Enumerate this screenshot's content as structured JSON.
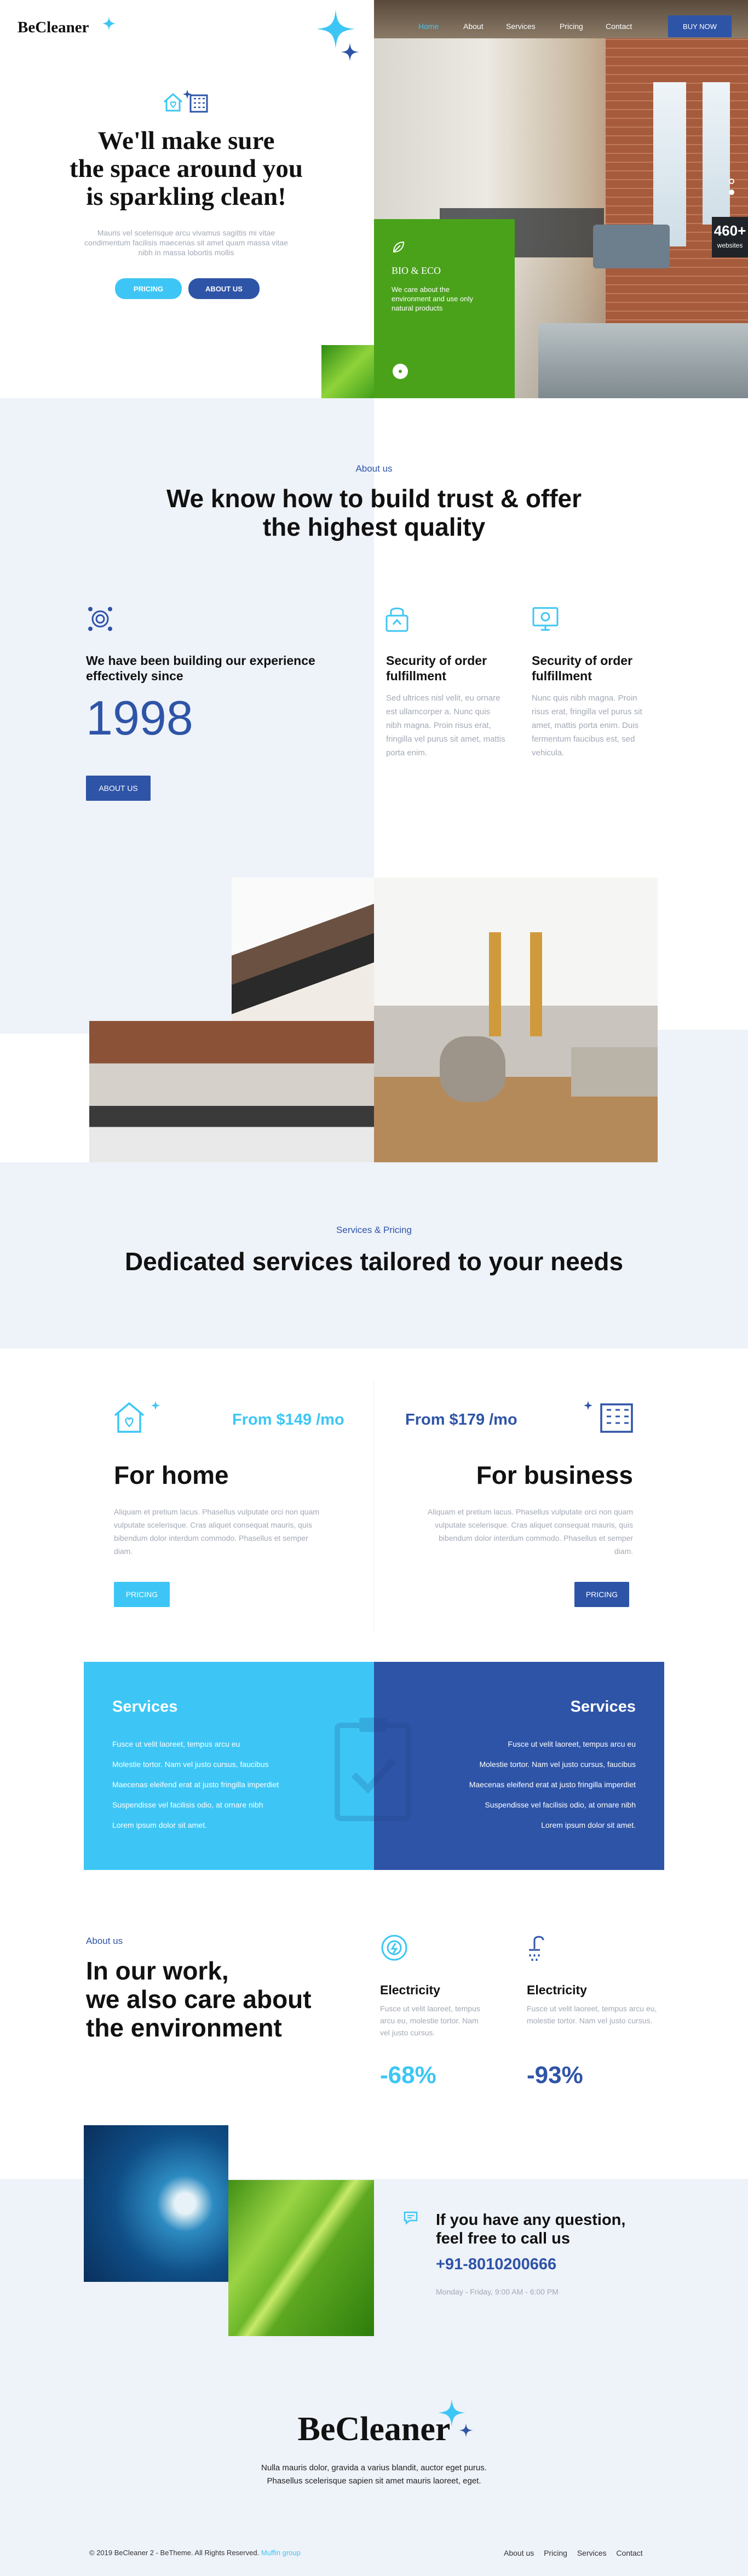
{
  "brand": {
    "name": "BeCleaner"
  },
  "nav": {
    "items": [
      "Home",
      "About",
      "Services",
      "Pricing",
      "Contact"
    ],
    "buy_label": "BUY NOW"
  },
  "hero": {
    "title_line1": "We'll make sure",
    "title_line2": "the space around you",
    "title_line3": "is sparkling clean!",
    "text_line1": "Mauris vel scelerisque arcu vivamus sagittis mi vitae",
    "text_line2": "condimentum facilisis maecenas sit amet quam massa vitae",
    "text_line3": "nibh in massa lobortis mollis",
    "pricing_label": "PRICING",
    "about_label": "ABOUT US",
    "counter_value": "460+",
    "counter_label": "websites",
    "card_title": "BIO & ECO",
    "card_text": "We care about the environment and use only natural products"
  },
  "about": {
    "eyebrow": "About us",
    "title_line1": "We know how to build trust & offer",
    "title_line2": "the highest quality",
    "since_title_line1": "We have been building our experience",
    "since_title_line2": "effectively since",
    "year": "1998",
    "button_label": "ABOUT US",
    "features": [
      {
        "title_line1": "Security of order",
        "title_line2": "fulfillment",
        "text": "Sed ultrices nisl velit, eu ornare est ullamcorper a. Nunc quis nibh magna. Proin risus erat, fringilla vel purus sit amet, mattis porta enim."
      },
      {
        "title_line1": "Security of order",
        "title_line2": "fulfillment",
        "text": "Nunc quis nibh magna. Proin risus erat, fringilla vel purus sit amet, mattis porta enim. Duis fermentum faucibus est, sed vehicula."
      }
    ]
  },
  "services_intro": {
    "eyebrow": "Services & Pricing",
    "title": "Dedicated services tailored to your needs"
  },
  "pricing": {
    "home": {
      "price": "From $149 /mo",
      "title": "For home",
      "text": "Aliquam et pretium lacus. Phasellus vulputate orci non quam vulputate scelerisque. Cras aliquet consequat mauris, quis bibendum dolor interdum commodo. Phasellus et semper diam.",
      "button": "PRICING"
    },
    "business": {
      "price": "From $179 /mo",
      "title": "For business",
      "text": "Aliquam et pretium lacus. Phasellus vulputate orci non quam vulputate scelerisque. Cras aliquet consequat mauris, quis bibendum dolor interdum commodo. Phasellus et semper diam.",
      "button": "PRICING"
    }
  },
  "services_lists": {
    "left_title": "Services",
    "left_items": [
      "Fusce ut velit laoreet, tempus arcu eu",
      "Molestie tortor. Nam vel justo cursus, faucibus",
      "Maecenas eleifend erat at justo fringilla imperdiet",
      "Suspendisse vel facilisis odio, at ornare nibh",
      "Lorem ipsum dolor sit amet."
    ],
    "right_title": "Services",
    "right_items": [
      "Fusce ut velit laoreet, tempus arcu eu",
      "Molestie tortor. Nam vel justo cursus, faucibus",
      "Maecenas eleifend erat at justo fringilla imperdiet",
      "Suspendisse vel facilisis odio, at ornare nibh",
      "Lorem ipsum dolor sit amet."
    ]
  },
  "environment": {
    "eyebrow": "About us",
    "title_line1": "In our work,",
    "title_line2": "we also care about",
    "title_line3": "the environment",
    "stats": [
      {
        "title": "Electricity",
        "text": "Fusce ut velit laoreet, tempus arcu eu, molestie tortor. Nam vel justo cursus.",
        "value": "-68%"
      },
      {
        "title": "Electricity",
        "text": "Fusce ut velit laoreet, tempus arcu eu, molestie tortor. Nam vel justo cursus.",
        "value": "-93%"
      }
    ]
  },
  "contact": {
    "title_line1": "If you have any question,",
    "title_line2": "feel free to call us",
    "phone": "+91-8010200666",
    "hours": "Monday - Friday, 9:00 AM - 6:00 PM"
  },
  "footer": {
    "text_line1": "Nulla mauris dolor, gravida a varius blandit, auctor eget purus.",
    "text_line2": "Phasellus scelerisque sapien sit amet mauris laoreet, eget.",
    "copyright": "© 2019 BeCleaner 2 - BeTheme. All Rights Reserved.",
    "credit": "Muffin group",
    "links": [
      "About us",
      "Pricing",
      "Services",
      "Contact"
    ]
  },
  "colors": {
    "accent_blue": "#2e54a7",
    "accent_cyan": "#3dc6f5",
    "eco_green": "#4aa21b",
    "bg_light": "#eef2f9"
  }
}
